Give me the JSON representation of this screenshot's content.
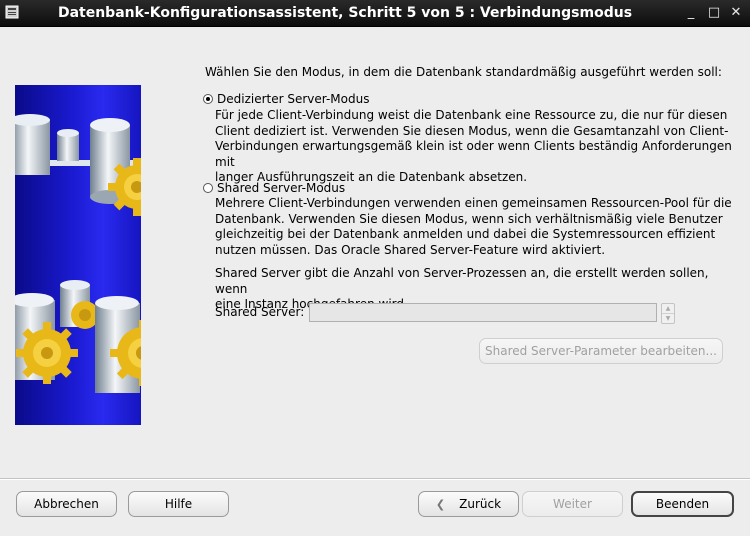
{
  "window": {
    "title": "Datenbank-Konfigurationsassistent, Schritt 5 von 5 : Verbindungsmodus",
    "controls": {
      "minimize": "_",
      "maximize": "□",
      "close": "✕"
    }
  },
  "intro_text": "Wählen Sie den Modus, in dem die Datenbank standardmäßig ausgeführt werden soll:",
  "options": {
    "dedicated": {
      "label": "Dedizierter Server-Modus",
      "selected": true,
      "description": "Für jede Client-Verbindung weist die Datenbank eine Ressource zu, die nur für diesen\nClient dediziert ist. Verwenden Sie diesen Modus, wenn die Gesamtanzahl von Client-\nVerbindungen erwartungsgemäß klein ist oder wenn Clients beständig Anforderungen mit\nlanger Ausführungszeit an die Datenbank absetzen."
    },
    "shared": {
      "label": "Shared Server-Modus",
      "selected": false,
      "description": "Mehrere Client-Verbindungen verwenden einen gemeinsamen Ressourcen-Pool für die\nDatenbank. Verwenden Sie diesen Modus, wenn sich verhältnismäßig viele Benutzer\ngleichzeitig bei der Datenbank anmelden und dabei die Systemressourcen effizient\nnutzen müssen. Das Oracle Shared Server-Feature wird aktiviert."
    }
  },
  "shared_server": {
    "info": "Shared Server gibt die Anzahl von Server-Prozessen an, die erstellt werden sollen, wenn\neine Instanz hochgefahren wird.",
    "label": "Shared Server:",
    "value": "",
    "params_button": "Shared Server-Parameter bearbeiten..."
  },
  "buttons": {
    "cancel": "Abbrechen",
    "help": "Hilfe",
    "back": "Zurück",
    "next": "Weiter",
    "finish": "Beenden"
  },
  "icons": {
    "app": "window-menu-icon",
    "back_arrow": "arrow-left-icon"
  },
  "colors": {
    "titlebar": "#111111",
    "panel_blue": "#1a1ad0",
    "gear_yellow": "#f0c020",
    "window_bg": "#ededed"
  }
}
